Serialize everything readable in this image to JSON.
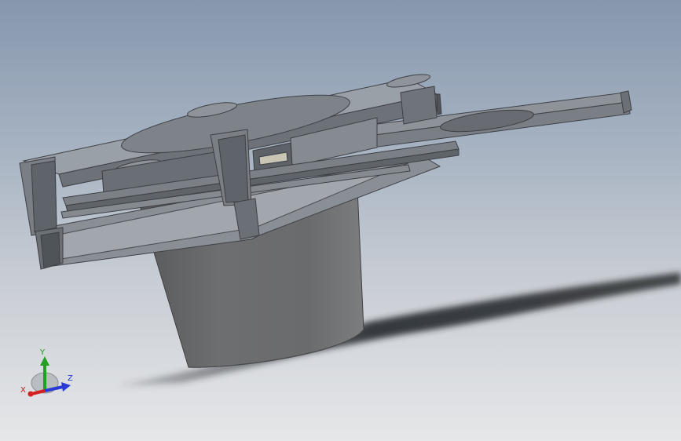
{
  "view": {
    "description_free": true,
    "colors": {
      "background_top": "#8697ad",
      "background_bottom": "#e6e7e9",
      "model_dark": "#565a60",
      "model_mid": "#7a7f86",
      "model_light": "#a6abb2",
      "cylinder": "#6a6b6d",
      "shadow": "#2a2d31"
    }
  },
  "triad": {
    "x_label": "X",
    "y_label": "Y",
    "z_label": "Z",
    "x_color": "#d42020",
    "y_color": "#22a022",
    "z_color": "#2a3ad8"
  }
}
